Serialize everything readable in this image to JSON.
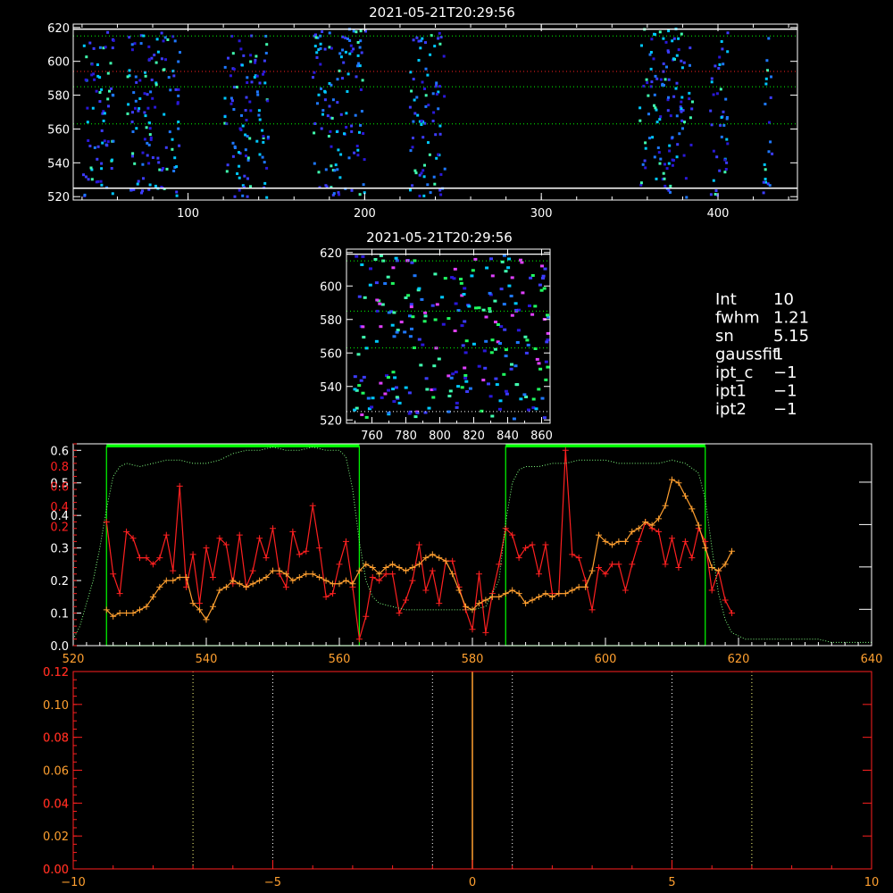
{
  "colors": {
    "background": "#000000",
    "axis": "#ffffff",
    "overlay_axis": "#ff2020",
    "green_box": "#00ff00",
    "green_dotted": "#80ff80",
    "red_series": "#ff2020",
    "orange_series": "#ffa030",
    "white_dotted": "#ffffff",
    "pixels": [
      "#2a18d8",
      "#3c3cff",
      "#1e78ff",
      "#00c8ff",
      "#40ffb0",
      "#20ff60",
      "#e040ff"
    ]
  },
  "info": {
    "lines": [
      {
        "name": "Int",
        "value": "10"
      },
      {
        "name": "fwhm",
        "value": "1.21"
      },
      {
        "name": "sn",
        "value": "5.15"
      },
      {
        "name": "gaussfit",
        "value": "1"
      },
      {
        "name": "ipt_c",
        "value": "−1"
      },
      {
        "name": "ipt1",
        "value": "−1"
      },
      {
        "name": "ipt2",
        "value": "−1"
      }
    ]
  },
  "chart_data": [
    {
      "type": "heatmap",
      "title": "2021-05-21T20:29:56",
      "xlim": [
        35,
        445
      ],
      "ylim": [
        518,
        622
      ],
      "x_ticks": [
        "100",
        "200",
        "300",
        "400"
      ],
      "y_ticks": [
        "520",
        "540",
        "560",
        "580",
        "600",
        "620"
      ],
      "column_bands_x": [
        [
          40,
          58
        ],
        [
          65,
          95
        ],
        [
          120,
          145
        ],
        [
          170,
          200
        ],
        [
          225,
          245
        ],
        [
          355,
          385
        ],
        [
          395,
          405
        ],
        [
          425,
          430
        ]
      ],
      "solid_lines_y": [
        619,
        525
      ],
      "green_dotted_y": [
        615,
        585,
        563
      ],
      "red_dotted_y": [
        594
      ]
    },
    {
      "type": "heatmap",
      "title": "2021-05-21T20:29:56",
      "xlim": [
        745,
        865
      ],
      "ylim": [
        518,
        622
      ],
      "x_ticks": [
        "760",
        "780",
        "800",
        "820",
        "840",
        "860"
      ],
      "y_ticks": [
        "520",
        "540",
        "560",
        "580",
        "600",
        "620"
      ],
      "solid_lines_y": [
        619
      ],
      "white_dotted_y": [
        525
      ],
      "green_dotted_y": [
        615,
        585,
        563
      ]
    },
    {
      "type": "line",
      "xlim": [
        520,
        640
      ],
      "ylim": [
        0,
        0.62
      ],
      "x_ticks": [
        "520",
        "540",
        "560",
        "580",
        "600",
        "620",
        "640"
      ],
      "left_ticks": [
        "0.0",
        "0.1",
        "0.2",
        "0.3",
        "0.4",
        "0.5",
        "0.6"
      ],
      "overlay_left_ticks": [
        "0.2",
        "0.4",
        "0.6",
        "0.8"
      ],
      "green_boxes": [
        [
          525,
          563
        ],
        [
          585,
          615
        ]
      ],
      "series": [
        {
          "color_key": "red_series",
          "x": [
            525,
            526,
            527,
            528,
            529,
            530,
            531,
            532,
            533,
            534,
            535,
            536,
            537,
            538,
            539,
            540,
            541,
            542,
            543,
            544,
            545,
            546,
            547,
            548,
            549,
            550,
            551,
            552,
            553,
            554,
            555,
            556,
            557,
            558,
            559,
            560,
            561,
            562,
            563,
            564,
            565,
            566,
            567,
            568,
            569,
            570,
            571,
            572,
            573,
            574,
            575,
            576,
            577,
            578,
            579,
            580,
            581,
            582,
            583,
            584,
            585,
            586,
            587,
            588,
            589,
            590,
            591,
            592,
            593,
            594,
            595,
            596,
            597,
            598,
            599,
            600,
            601,
            602,
            603,
            604,
            605,
            606,
            607,
            608,
            609,
            610,
            611,
            612,
            613,
            614,
            615,
            616,
            617,
            618,
            619
          ],
          "y": [
            0.38,
            0.22,
            0.16,
            0.35,
            0.33,
            0.27,
            0.27,
            0.25,
            0.27,
            0.34,
            0.23,
            0.49,
            0.18,
            0.28,
            0.13,
            0.3,
            0.21,
            0.33,
            0.31,
            0.19,
            0.34,
            0.18,
            0.23,
            0.33,
            0.27,
            0.36,
            0.22,
            0.18,
            0.35,
            0.28,
            0.29,
            0.43,
            0.3,
            0.15,
            0.16,
            0.25,
            0.32,
            0.18,
            0.02,
            0.09,
            0.21,
            0.2,
            0.22,
            0.22,
            0.1,
            0.14,
            0.2,
            0.31,
            0.17,
            0.23,
            0.13,
            0.26,
            0.26,
            0.18,
            0.11,
            0.05,
            0.22,
            0.04,
            0.16,
            0.25,
            0.36,
            0.34,
            0.27,
            0.3,
            0.31,
            0.22,
            0.31,
            0.16,
            0.16,
            0.6,
            0.28,
            0.27,
            0.2,
            0.11,
            0.24,
            0.22,
            0.25,
            0.25,
            0.17,
            0.25,
            0.32,
            0.38,
            0.36,
            0.35,
            0.25,
            0.33,
            0.24,
            0.32,
            0.27,
            0.36,
            0.32,
            0.17,
            0.23,
            0.14,
            0.1
          ]
        },
        {
          "color_key": "orange_series",
          "x": [
            525,
            526,
            527,
            528,
            529,
            530,
            531,
            532,
            533,
            534,
            535,
            536,
            537,
            538,
            539,
            540,
            541,
            542,
            543,
            544,
            545,
            546,
            547,
            548,
            549,
            550,
            551,
            552,
            553,
            554,
            555,
            556,
            557,
            558,
            559,
            560,
            561,
            562,
            563,
            564,
            565,
            566,
            567,
            568,
            569,
            570,
            571,
            572,
            573,
            574,
            575,
            576,
            577,
            578,
            579,
            580,
            581,
            582,
            583,
            584,
            585,
            586,
            587,
            588,
            589,
            590,
            591,
            592,
            593,
            594,
            595,
            596,
            597,
            598,
            599,
            600,
            601,
            602,
            603,
            604,
            605,
            606,
            607,
            608,
            609,
            610,
            611,
            612,
            613,
            614,
            615,
            616,
            617,
            618,
            619
          ],
          "y": [
            0.11,
            0.09,
            0.1,
            0.1,
            0.1,
            0.11,
            0.12,
            0.15,
            0.18,
            0.2,
            0.2,
            0.21,
            0.21,
            0.13,
            0.11,
            0.08,
            0.12,
            0.17,
            0.18,
            0.2,
            0.19,
            0.18,
            0.19,
            0.2,
            0.21,
            0.23,
            0.23,
            0.22,
            0.2,
            0.21,
            0.22,
            0.22,
            0.21,
            0.2,
            0.19,
            0.19,
            0.2,
            0.19,
            0.23,
            0.25,
            0.24,
            0.22,
            0.24,
            0.25,
            0.24,
            0.23,
            0.24,
            0.25,
            0.27,
            0.28,
            0.27,
            0.26,
            0.22,
            0.17,
            0.12,
            0.11,
            0.13,
            0.14,
            0.15,
            0.15,
            0.16,
            0.17,
            0.16,
            0.13,
            0.14,
            0.15,
            0.16,
            0.15,
            0.16,
            0.16,
            0.17,
            0.18,
            0.18,
            0.23,
            0.34,
            0.32,
            0.31,
            0.32,
            0.32,
            0.35,
            0.36,
            0.38,
            0.37,
            0.39,
            0.43,
            0.51,
            0.5,
            0.46,
            0.42,
            0.37,
            0.3,
            0.24,
            0.23,
            0.25,
            0.29
          ]
        },
        {
          "color_key": "green_dotted",
          "x": [
            520,
            521,
            522,
            523,
            524,
            525,
            526,
            527,
            528,
            530,
            532,
            534,
            536,
            538,
            540,
            542,
            544,
            546,
            548,
            550,
            552,
            554,
            556,
            558,
            560,
            561,
            562,
            563,
            564,
            565,
            566,
            568,
            570,
            572,
            574,
            576,
            578,
            580,
            582,
            584,
            585,
            586,
            587,
            588,
            589,
            590,
            592,
            594,
            596,
            598,
            600,
            602,
            604,
            606,
            608,
            610,
            612,
            614,
            615,
            616,
            617,
            618,
            619,
            620,
            621,
            622,
            623,
            624,
            626,
            628,
            630,
            632,
            634,
            636,
            638,
            640
          ],
          "y": [
            0.02,
            0.06,
            0.13,
            0.2,
            0.3,
            0.42,
            0.52,
            0.55,
            0.56,
            0.55,
            0.56,
            0.57,
            0.57,
            0.56,
            0.56,
            0.57,
            0.59,
            0.6,
            0.6,
            0.61,
            0.6,
            0.6,
            0.61,
            0.6,
            0.6,
            0.58,
            0.48,
            0.32,
            0.2,
            0.15,
            0.13,
            0.12,
            0.11,
            0.11,
            0.11,
            0.11,
            0.11,
            0.11,
            0.12,
            0.2,
            0.38,
            0.5,
            0.54,
            0.55,
            0.55,
            0.55,
            0.56,
            0.56,
            0.57,
            0.57,
            0.57,
            0.56,
            0.56,
            0.56,
            0.56,
            0.57,
            0.56,
            0.53,
            0.45,
            0.3,
            0.16,
            0.08,
            0.04,
            0.03,
            0.02,
            0.02,
            0.02,
            0.02,
            0.02,
            0.02,
            0.02,
            0.02,
            0.01,
            0.01,
            0.01,
            0.01
          ]
        }
      ]
    },
    {
      "type": "line",
      "xlim": [
        -10,
        10
      ],
      "ylim": [
        0,
        0.12
      ],
      "x_ticks": [
        "−10",
        "−5",
        "0",
        "5",
        "10"
      ],
      "left_ticks": [
        "0.00",
        "0.02",
        "0.04",
        "0.06",
        "0.08",
        "0.10",
        "0.12"
      ],
      "overlay_left_ticks": [
        "0.00",
        "0.04",
        "0.08",
        "0.12"
      ],
      "vertical_line_x": 0,
      "dotted_x_yellow": [
        -7,
        7
      ],
      "dotted_x_white": [
        -5,
        -1,
        1,
        5
      ]
    }
  ]
}
